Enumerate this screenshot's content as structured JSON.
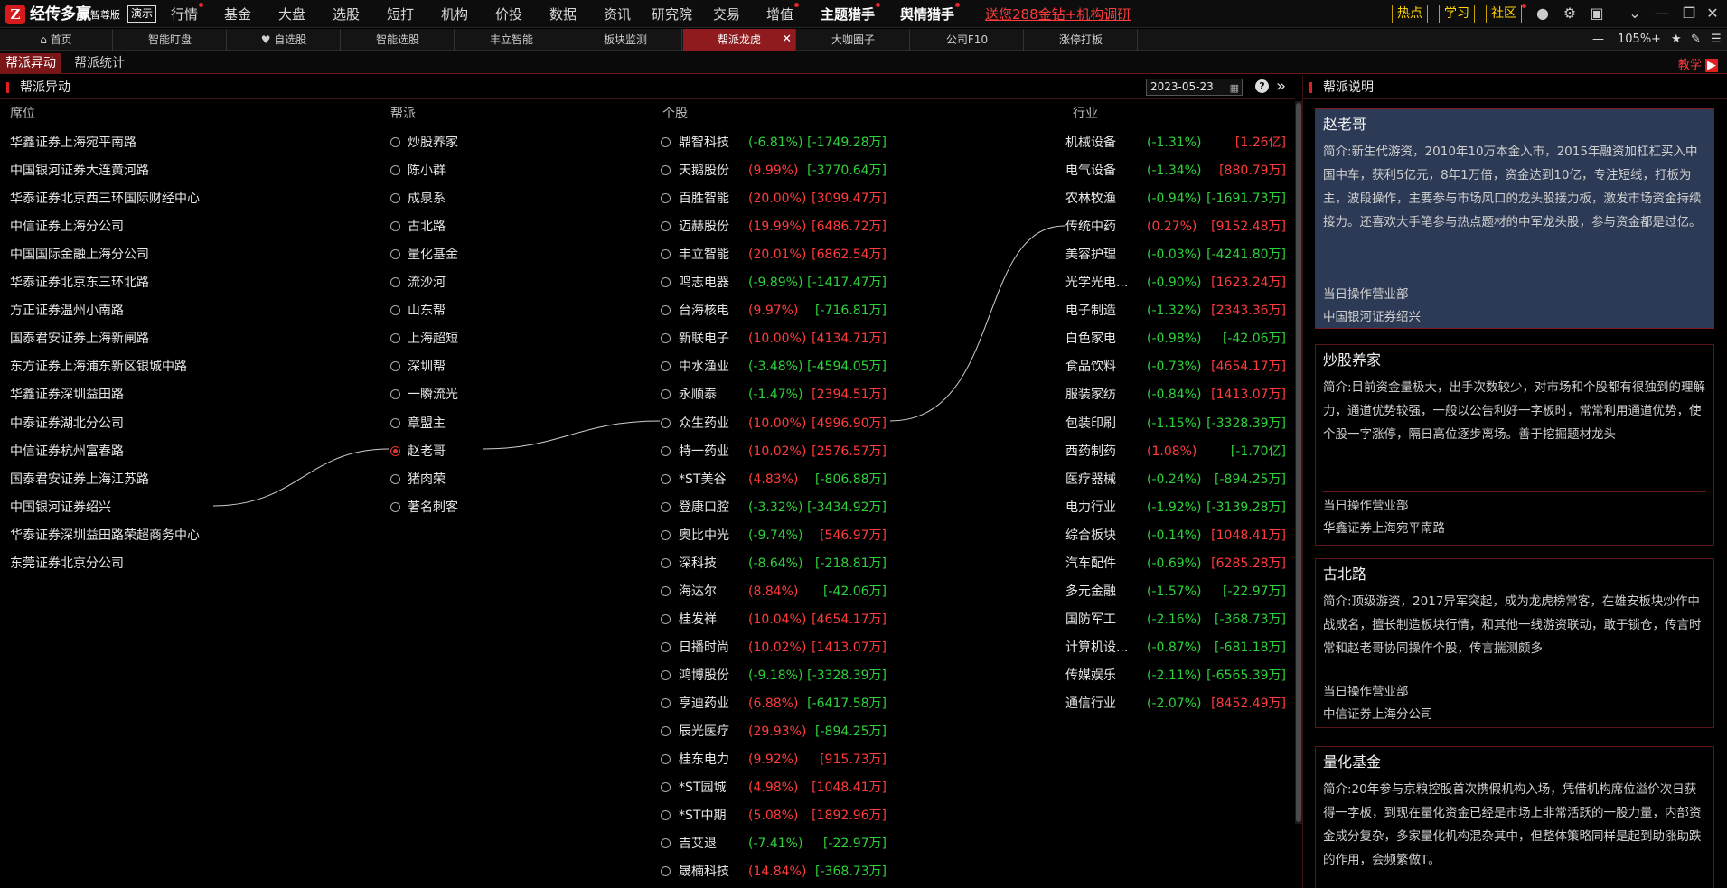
{
  "app": {
    "brand": "经传多赢",
    "edition": "智尊版",
    "demo": "演示"
  },
  "topmenu": [
    "行情",
    "基金",
    "大盘",
    "选股",
    "短打",
    "机构",
    "价投",
    "数据",
    "资讯",
    "研究院",
    "交易",
    "增值",
    "主题猎手",
    "舆情猎手"
  ],
  "promo": "送您288金钻+机构调研",
  "topright": [
    "热点",
    "学习",
    "社区"
  ],
  "tabs": [
    "首页",
    "智能盯盘",
    "自选股",
    "智能选股",
    "丰立智能",
    "板块监测",
    "帮派龙虎",
    "大咖圈子",
    "公司F10",
    "涨停打板"
  ],
  "zoom": "105%",
  "subtabs": [
    "帮派异动",
    "帮派统计"
  ],
  "teach": "教学",
  "main": {
    "title": "帮派异动",
    "date": "2023-05-23"
  },
  "columns": {
    "seat": "席位",
    "faction": "帮派",
    "stock": "个股",
    "industry": "行业"
  },
  "seats": [
    "华鑫证券上海宛平南路",
    "中国银河证券大连黄河路",
    "华泰证券北京西三环国际财经中心",
    "中信证券上海分公司",
    "中国国际金融上海分公司",
    "华泰证券北京东三环北路",
    "方正证券温州小南路",
    "国泰君安证券上海新闸路",
    "东方证券上海浦东新区银城中路",
    "华鑫证券深圳益田路",
    "中泰证券湖北分公司",
    "中信证券杭州富春路",
    "国泰君安证券上海江苏路",
    "中国银河证券绍兴",
    "华泰证券深圳益田路荣超商务中心",
    "东莞证券北京分公司"
  ],
  "factions": [
    "炒股养家",
    "陈小群",
    "成泉系",
    "古北路",
    "量化基金",
    "流沙河",
    "山东帮",
    "上海超短",
    "深圳帮",
    "一瞬流光",
    "章盟主",
    "赵老哥",
    "猪肉荣",
    "著名刺客"
  ],
  "selected_faction": "赵老哥",
  "stocks": [
    {
      "name": "鼎智科技",
      "chg": "(-6.81%)",
      "amt": "[-1749.28万]",
      "c": "dn",
      "a": "dn"
    },
    {
      "name": "天鹅股份",
      "chg": "(9.99%)",
      "amt": "[-3770.64万]",
      "c": "up",
      "a": "dn"
    },
    {
      "name": "百胜智能",
      "chg": "(20.00%)",
      "amt": "[3099.47万]",
      "c": "up",
      "a": "up"
    },
    {
      "name": "迈赫股份",
      "chg": "(19.99%)",
      "amt": "[6486.72万]",
      "c": "up",
      "a": "up"
    },
    {
      "name": "丰立智能",
      "chg": "(20.01%)",
      "amt": "[6862.54万]",
      "c": "up",
      "a": "up"
    },
    {
      "name": "鸣志电器",
      "chg": "(-9.89%)",
      "amt": "[-1417.47万]",
      "c": "dn",
      "a": "dn"
    },
    {
      "name": "台海核电",
      "chg": "(9.97%)",
      "amt": "[-716.81万]",
      "c": "up",
      "a": "dn"
    },
    {
      "name": "新联电子",
      "chg": "(10.00%)",
      "amt": "[4134.71万]",
      "c": "up",
      "a": "up"
    },
    {
      "name": "中水渔业",
      "chg": "(-3.48%)",
      "amt": "[-4594.05万]",
      "c": "dn",
      "a": "dn"
    },
    {
      "name": "永顺泰",
      "chg": "(-1.47%)",
      "amt": "[2394.51万]",
      "c": "dn",
      "a": "up"
    },
    {
      "name": "众生药业",
      "chg": "(10.00%)",
      "amt": "[4996.90万]",
      "c": "up",
      "a": "up"
    },
    {
      "name": "特一药业",
      "chg": "(10.02%)",
      "amt": "[2576.57万]",
      "c": "up",
      "a": "up"
    },
    {
      "name": "*ST美谷",
      "chg": "(4.83%)",
      "amt": "[-806.88万]",
      "c": "up",
      "a": "dn"
    },
    {
      "name": "登康口腔",
      "chg": "(-3.32%)",
      "amt": "[-3434.92万]",
      "c": "dn",
      "a": "dn"
    },
    {
      "name": "奥比中光",
      "chg": "(-9.74%)",
      "amt": "[546.97万]",
      "c": "dn",
      "a": "up"
    },
    {
      "name": "深科技",
      "chg": "(-8.64%)",
      "amt": "[-218.81万]",
      "c": "dn",
      "a": "dn"
    },
    {
      "name": "海达尔",
      "chg": "(8.84%)",
      "amt": "[-42.06万]",
      "c": "up",
      "a": "dn"
    },
    {
      "name": "桂发祥",
      "chg": "(10.04%)",
      "amt": "[4654.17万]",
      "c": "up",
      "a": "up"
    },
    {
      "name": "日播时尚",
      "chg": "(10.02%)",
      "amt": "[1413.07万]",
      "c": "up",
      "a": "up"
    },
    {
      "name": "鸿博股份",
      "chg": "(-9.18%)",
      "amt": "[-3328.39万]",
      "c": "dn",
      "a": "dn"
    },
    {
      "name": "亨迪药业",
      "chg": "(6.88%)",
      "amt": "[-6417.58万]",
      "c": "up",
      "a": "dn"
    },
    {
      "name": "辰光医疗",
      "chg": "(29.93%)",
      "amt": "[-894.25万]",
      "c": "up",
      "a": "dn"
    },
    {
      "name": "桂东电力",
      "chg": "(9.92%)",
      "amt": "[915.73万]",
      "c": "up",
      "a": "up"
    },
    {
      "name": "*ST园城",
      "chg": "(4.98%)",
      "amt": "[1048.41万]",
      "c": "up",
      "a": "up"
    },
    {
      "name": "*ST中期",
      "chg": "(5.08%)",
      "amt": "[1892.96万]",
      "c": "up",
      "a": "up"
    },
    {
      "name": "吉艾退",
      "chg": "(-7.41%)",
      "amt": "[-22.97万]",
      "c": "dn",
      "a": "dn"
    },
    {
      "name": "晟楠科技",
      "chg": "(14.84%)",
      "amt": "[-368.73万]",
      "c": "up",
      "a": "dn"
    }
  ],
  "industries": [
    {
      "name": "机械设备",
      "chg": "(-1.31%)",
      "amt": "[1.26亿]",
      "c": "dn",
      "a": "up"
    },
    {
      "name": "电气设备",
      "chg": "(-1.34%)",
      "amt": "[880.79万]",
      "c": "dn",
      "a": "up"
    },
    {
      "name": "农林牧渔",
      "chg": "(-0.94%)",
      "amt": "[-1691.73万]",
      "c": "dn",
      "a": "dn"
    },
    {
      "name": "传统中药",
      "chg": "(0.27%)",
      "amt": "[9152.48万]",
      "c": "up",
      "a": "up"
    },
    {
      "name": "美容护理",
      "chg": "(-0.03%)",
      "amt": "[-4241.80万]",
      "c": "dn",
      "a": "dn"
    },
    {
      "name": "光学光电...",
      "chg": "(-0.90%)",
      "amt": "[1623.24万]",
      "c": "dn",
      "a": "up"
    },
    {
      "name": "电子制造",
      "chg": "(-1.32%)",
      "amt": "[2343.36万]",
      "c": "dn",
      "a": "up"
    },
    {
      "name": "白色家电",
      "chg": "(-0.98%)",
      "amt": "[-42.06万]",
      "c": "dn",
      "a": "dn"
    },
    {
      "name": "食品饮料",
      "chg": "(-0.73%)",
      "amt": "[4654.17万]",
      "c": "dn",
      "a": "up"
    },
    {
      "name": "服装家纺",
      "chg": "(-0.84%)",
      "amt": "[1413.07万]",
      "c": "dn",
      "a": "up"
    },
    {
      "name": "包装印刷",
      "chg": "(-1.15%)",
      "amt": "[-3328.39万]",
      "c": "dn",
      "a": "dn"
    },
    {
      "name": "西药制药",
      "chg": "(1.08%)",
      "amt": "[-1.70亿]",
      "c": "up",
      "a": "dn"
    },
    {
      "name": "医疗器械",
      "chg": "(-0.24%)",
      "amt": "[-894.25万]",
      "c": "dn",
      "a": "dn"
    },
    {
      "name": "电力行业",
      "chg": "(-1.92%)",
      "amt": "[-3139.28万]",
      "c": "dn",
      "a": "dn"
    },
    {
      "name": "综合板块",
      "chg": "(-0.14%)",
      "amt": "[1048.41万]",
      "c": "dn",
      "a": "up"
    },
    {
      "name": "汽车配件",
      "chg": "(-0.69%)",
      "amt": "[6285.28万]",
      "c": "dn",
      "a": "up"
    },
    {
      "name": "多元金融",
      "chg": "(-1.57%)",
      "amt": "[-22.97万]",
      "c": "dn",
      "a": "dn"
    },
    {
      "name": "国防军工",
      "chg": "(-2.16%)",
      "amt": "[-368.73万]",
      "c": "dn",
      "a": "dn"
    },
    {
      "name": "计算机设...",
      "chg": "(-0.87%)",
      "amt": "[-681.18万]",
      "c": "dn",
      "a": "dn"
    },
    {
      "name": "传媒娱乐",
      "chg": "(-2.11%)",
      "amt": "[-6565.39万]",
      "c": "dn",
      "a": "dn"
    },
    {
      "name": "通信行业",
      "chg": "(-2.07%)",
      "amt": "[8452.49万]",
      "c": "dn",
      "a": "up"
    }
  ],
  "side": {
    "title": "帮派说明",
    "op_label": "当日操作营业部",
    "cards": [
      {
        "name": "赵老哥",
        "desc": "简介:新生代游资，2010年10万本金入市，2015年融资加杠杠买入中国中车，获利5亿元，8年1万倍，资金达到10亿，专注短线，打板为主，波段操作，主要参与市场风口的龙头股接力板，激发市场资金持续接力。还喜欢大手笔参与热点题材的中军龙头股，参与资金都是过亿。",
        "dept": "中国银河证券绍兴"
      },
      {
        "name": "炒股养家",
        "desc": "简介:目前资金量极大，出手次数较少，对市场和个股都有很独到的理解力，通道优势较强，一般以公告利好一字板时，常常利用通道优势，使个股一字涨停，隔日高位逐步离场。善于挖掘题材龙头",
        "dept": "华鑫证券上海宛平南路"
      },
      {
        "name": "古北路",
        "desc": "简介:顶级游资，2017异军突起，成为龙虎榜常客，在雄安板块炒作中战成名，擅长制造板块行情，和其他一线游资联动，敢于锁仓，传言时常和赵老哥协同操作个股，传言揣测颇多",
        "dept": "中信证券上海分公司"
      },
      {
        "name": "量化基金",
        "desc": "简介:20年参与京粮控股首次携假机构入场，凭借机构席位溢价次日获得一字板，到现在量化资金已经是市场上非常活跃的一股力量，内部资金成分复杂，多家量化机构混杂其中，但整体策略同样是起到助涨助跌的作用，会频繁做T。",
        "dept": ""
      }
    ]
  }
}
